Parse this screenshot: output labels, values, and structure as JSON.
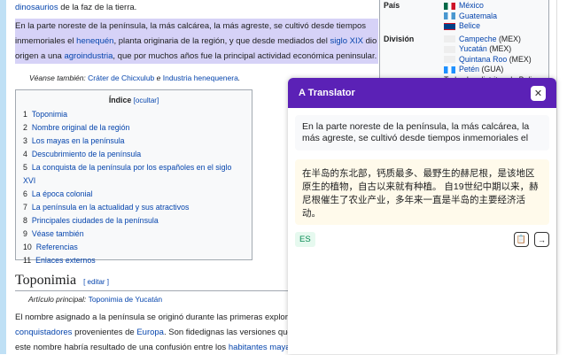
{
  "article": {
    "intro_link": "dinosaurios",
    "intro_rest": " de la faz de la tierra.",
    "p1": [
      "En la parte noreste de la península, la más calcárea, la más agreste, se cultivó desde tiempos inmemoriales el ",
      "henequén",
      ", planta originaria de la región, y que desde mediados del ",
      "siglo XIX",
      " dio origen a una ",
      "agroindustria",
      ", que por muchos años fue la principal actividad económica peninsular."
    ],
    "see_also_label": "Véanse también: ",
    "see_also_1": "Cráter de Chicxulub",
    "see_also_sep": " e ",
    "see_also_2": "Industria henequenera",
    "see_also_end": ".",
    "toc": {
      "title": "Índice",
      "toggle": "[ocultar]",
      "items": [
        {
          "num": "1",
          "label": "Toponimia"
        },
        {
          "num": "2",
          "label": "Nombre original de la región"
        },
        {
          "num": "3",
          "label": "Los mayas en la península"
        },
        {
          "num": "4",
          "label": "Descubrimiento de la península"
        },
        {
          "num": "5",
          "label": "La conquista de la península por los españoles en el siglo XVI"
        },
        {
          "num": "6",
          "label": "La época colonial"
        },
        {
          "num": "7",
          "label": "La península en la actualidad y sus atractivos"
        },
        {
          "num": "8",
          "label": "Principales ciudades de la península"
        },
        {
          "num": "9",
          "label": "Véase también"
        },
        {
          "num": "10",
          "label": "Referencias"
        },
        {
          "num": "11",
          "label": "Enlaces externos"
        }
      ]
    },
    "section_title": "Toponimia",
    "edit_label": "[ editar ]",
    "main_article_label": "Artículo principal: ",
    "main_article_link": "Toponimia de Yucatán",
    "p2": [
      "El nombre asignado a la península se originó durante las primeras exploraciones",
      "conquistadores",
      " provenientes de ",
      "Europa",
      ". Son fidedignas las versiones que",
      "este nombre habría resultado de una confusión entre los ",
      "habitantes mayas"
    ]
  },
  "infobox": {
    "country_label": "País",
    "countries": [
      "México",
      "Guatemala",
      "Belice"
    ],
    "division_label": "División",
    "divisions": [
      {
        "name": "Campeche",
        "suffix": " (MEX)"
      },
      {
        "name": "Yucatán",
        "suffix": " (MEX)"
      },
      {
        "name": "Quintana Roo",
        "suffix": " (MEX)"
      },
      {
        "name": "Petén",
        "suffix": " (GUA)"
      }
    ],
    "belize_districts": "Todos los distritos de Belice"
  },
  "translator": {
    "title": "A Translator",
    "close_icon": "close-icon",
    "source_text": "En la parte noreste de la península, la más calcárea, la más agreste, se cultivó desde tiempos inmemoriales el",
    "translated_text": "在半岛的东北部，钙质最多、最野生的赫尼根，是该地区原生的植物，自古以来就有种植。 自19世纪中期以来，赫尼根催生了农业产业，多年来一直是半岛的主要经济活动。",
    "source_lang": "ES",
    "copy_icon": "clipboard-icon",
    "insert_icon": "arrow-right-icon",
    "accent": "#5b21b6"
  }
}
